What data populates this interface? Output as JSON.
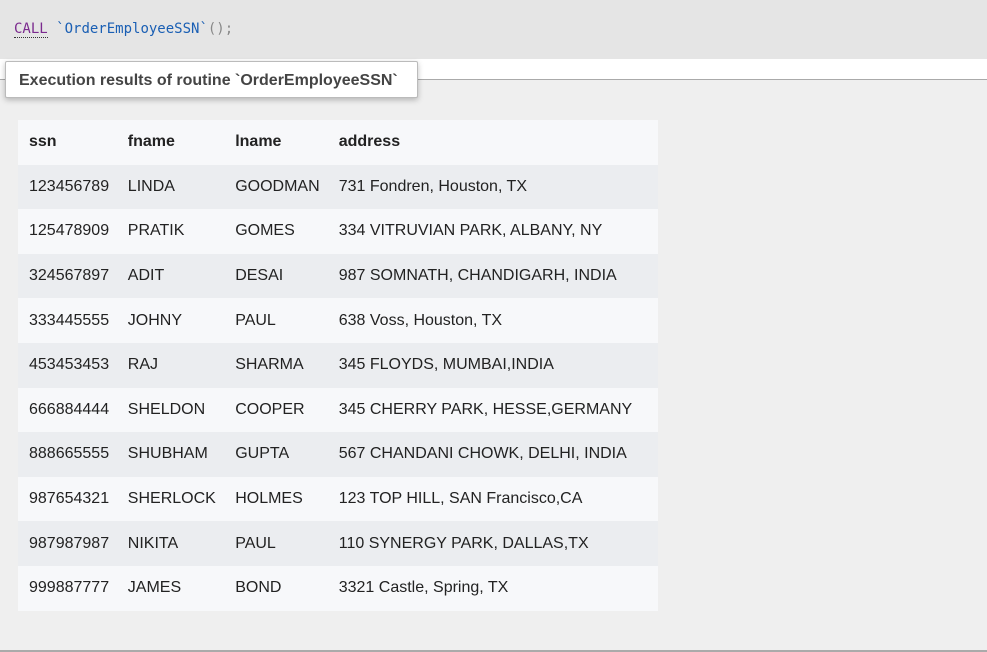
{
  "query": {
    "keyword": "CALL",
    "routine": "`OrderEmployeeSSN`",
    "parens": "();"
  },
  "tab": {
    "label": "Execution results of routine `OrderEmployeeSSN`"
  },
  "table": {
    "columns": [
      "ssn",
      "fname",
      "lname",
      "address"
    ],
    "rows": [
      [
        "123456789",
        "LINDA",
        "GOODMAN",
        "731 Fondren, Houston, TX"
      ],
      [
        "125478909",
        "PRATIK",
        "GOMES",
        "334 VITRUVIAN PARK, ALBANY, NY"
      ],
      [
        "324567897",
        "ADIT",
        "DESAI",
        "987 SOMNATH, CHANDIGARH, INDIA"
      ],
      [
        "333445555",
        "JOHNY",
        "PAUL",
        "638 Voss, Houston, TX"
      ],
      [
        "453453453",
        "RAJ",
        "SHARMA",
        "345 FLOYDS, MUMBAI,INDIA"
      ],
      [
        "666884444",
        "SHELDON",
        "COOPER",
        "345 CHERRY PARK, HESSE,GERMANY"
      ],
      [
        "888665555",
        "SHUBHAM",
        "GUPTA",
        "567 CHANDANI CHOWK, DELHI, INDIA"
      ],
      [
        "987654321",
        "SHERLOCK",
        "HOLMES",
        "123 TOP HILL, SAN Francisco,CA"
      ],
      [
        "987987987",
        "NIKITA",
        "PAUL",
        "110 SYNERGY PARK, DALLAS,TX"
      ],
      [
        "999887777",
        "JAMES",
        "BOND",
        "3321 Castle, Spring, TX"
      ]
    ]
  }
}
